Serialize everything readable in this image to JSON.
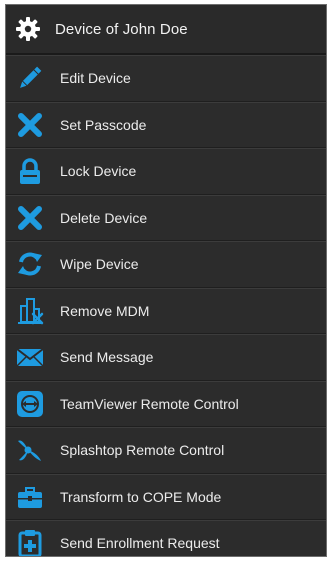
{
  "header": {
    "title": "Device of John Doe",
    "icon": "gear-icon"
  },
  "colors": {
    "accent": "#1e9be0",
    "background": "#2c2c2c",
    "text": "#ececec"
  },
  "menu": {
    "items": [
      {
        "label": "Edit Device",
        "icon": "pencil-icon"
      },
      {
        "label": "Set Passcode",
        "icon": "x-icon"
      },
      {
        "label": "Lock Device",
        "icon": "lock-icon"
      },
      {
        "label": "Delete Device",
        "icon": "x-icon"
      },
      {
        "label": "Wipe Device",
        "icon": "refresh-icon"
      },
      {
        "label": "Remove MDM",
        "icon": "remove-mdm-icon"
      },
      {
        "label": "Send Message",
        "icon": "envelope-icon"
      },
      {
        "label": "TeamViewer Remote Control",
        "icon": "teamviewer-icon"
      },
      {
        "label": "Splashtop Remote Control",
        "icon": "splashtop-icon"
      },
      {
        "label": "Transform to COPE Mode",
        "icon": "briefcase-icon"
      },
      {
        "label": "Send Enrollment Request",
        "icon": "clipboard-plus-icon"
      }
    ]
  }
}
